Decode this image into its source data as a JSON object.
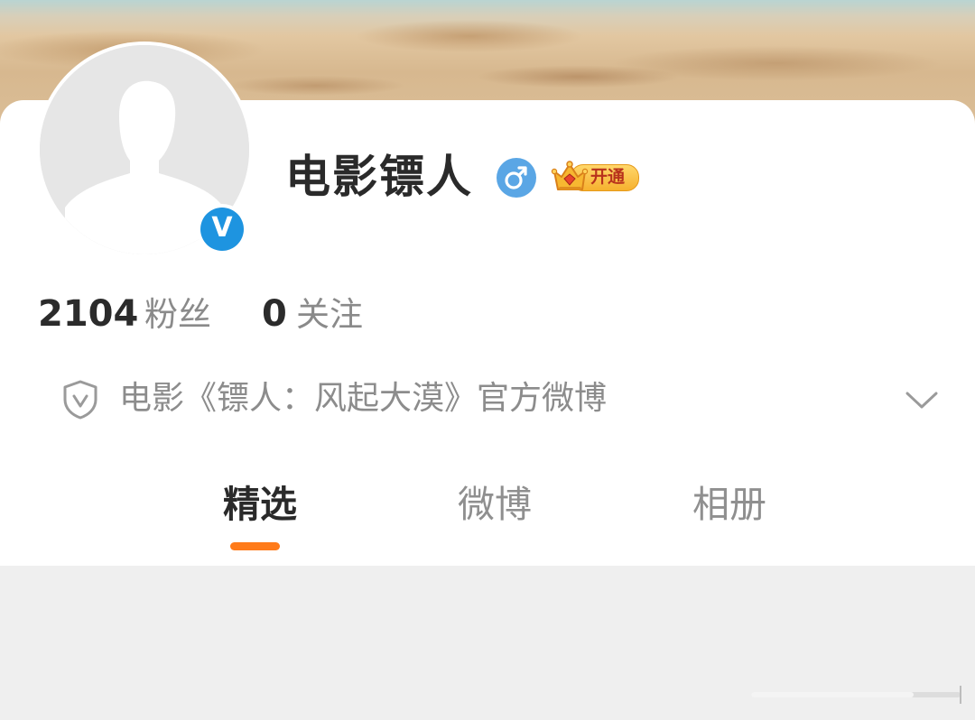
{
  "profile": {
    "name": "电影镖人",
    "gender_icon": "male-icon",
    "vip_label": "开通",
    "verified_icon": "verified-v-icon",
    "verified_mark": "V"
  },
  "stats": {
    "followers_count": "2104",
    "followers_label": "粉丝",
    "following_count": "0",
    "following_label": "关注"
  },
  "description": {
    "text": "电影《镖人：风起大漠》官方微博",
    "icon": "shield-v-icon",
    "expand_icon": "chevron-down-icon"
  },
  "tabs": [
    {
      "label": "精选",
      "active": true
    },
    {
      "label": "微博",
      "active": false
    },
    {
      "label": "相册",
      "active": false
    }
  ],
  "colors": {
    "accent": "#ff7b1a",
    "verified": "#1e94e0",
    "gender": "#5aa6e5",
    "vip_gold": "#f6b12f"
  }
}
